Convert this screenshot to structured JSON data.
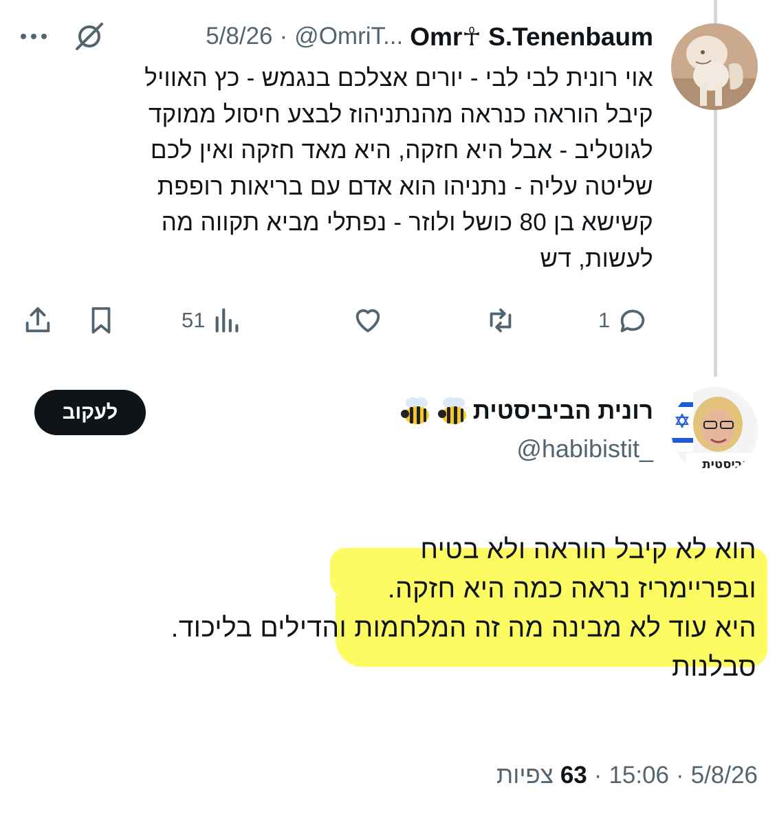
{
  "reply_tweet": {
    "display_name": "Omr☥ S.Tenenbaum",
    "handle": "@OmriT...",
    "date": "5/8/26",
    "separator": "·",
    "text_lines": [
      "אוי רונית לבי לבי - יורים אצלכם בנגמש - כץ האוויל",
      "קיבל הוראה כנראה מהנתניהוז לבצע חיסול ממוקד",
      "לגוטליב - אבל היא חזקה, היא מאד חזקה ואין לכם",
      "שליטה עליה - נתניהו הוא אדם עם בריאות רופפת",
      "קשישא בן 80 כושל ולוזר - נפתלי מביא תקווה מה",
      "לעשות, דש"
    ],
    "actions": {
      "reply_count": "1",
      "views_count": "51"
    }
  },
  "main_tweet": {
    "display_name": "רונית הביביסטית",
    "handle": "@habibistit_",
    "follow_label": "לעקוב",
    "text_lines": [
      "הוא לא קיבל הוראה ולא בטיח",
      "ובפריימריז נראה כמה היא חזקה.",
      "היא עוד לא מבינה מה זה המלחמות והדילים בליכוד.",
      "סבלנות"
    ],
    "date": "5/8/26",
    "time": "15:06",
    "views_number": "63",
    "views_label": "צפיות",
    "separator": "·"
  },
  "colors": {
    "text": "#0f1419",
    "secondary": "#536471",
    "highlight": "#fdfb62",
    "thread_line": "#cfd9de"
  },
  "icons": [
    "more-dots-icon",
    "no-reply-icon",
    "share-icon",
    "bookmark-icon",
    "views-icon",
    "like-icon",
    "retweet-icon",
    "reply-icon",
    "bee-emoji",
    "israel-flag"
  ]
}
